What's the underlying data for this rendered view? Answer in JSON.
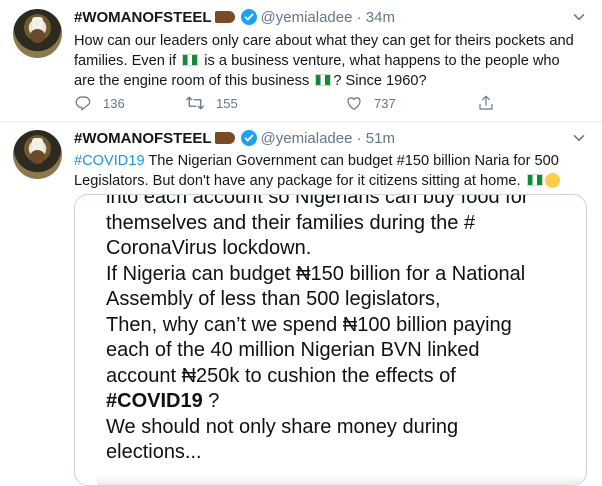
{
  "tweets": [
    {
      "name": "#WOMANOFSTEEL",
      "handle": "@yemialadee",
      "dot": "·",
      "time": "34m",
      "text_1": "How can our leaders only care about what they can get for theirs pockets and families. Even if ",
      "text_2": " is a business venture, what happens to the people who are the engine room of this business ",
      "text_3": "? Since 1960?",
      "replies": "136",
      "retweets": "155",
      "likes": "737"
    },
    {
      "name": "#WOMANOFSTEEL",
      "handle": "@yemialadee",
      "dot": "·",
      "time": "51m",
      "hashtag": "#COVID19",
      "text_1": " The Nigerian Government can budget #150 billion Naria for 500 Legislators. But don't have any package for it citizens sitting at home. ",
      "media_lines": [
        "into each account so Nigerians can buy food for",
        "themselves and their families during the #",
        "CoronaVirus lockdown.",
        "If Nigeria can budget ₦150 billion for a National",
        "Assembly of less than 500 legislators,",
        "Then, why can’t we spend ₦100 billion paying",
        "each of the 40 million Nigerian BVN linked",
        "account ₦250k to cushion the effects of",
        "#COVID19",
        " ?",
        "We should not only share money during",
        "elections..."
      ]
    }
  ],
  "icons": {
    "reply": "reply-icon",
    "retweet": "retweet-icon",
    "like": "heart-icon",
    "share": "share-icon",
    "more": "chevron-down-icon",
    "verified": "verified-badge-icon",
    "flag": "nigeria-flag-emoji",
    "hand": "pointing-hand-emoji",
    "sad": "crying-face-emoji"
  },
  "colors": {
    "link": "#1b95e0",
    "muted": "#657786",
    "verified": "#1da1f2",
    "border": "#e6ecf0"
  }
}
